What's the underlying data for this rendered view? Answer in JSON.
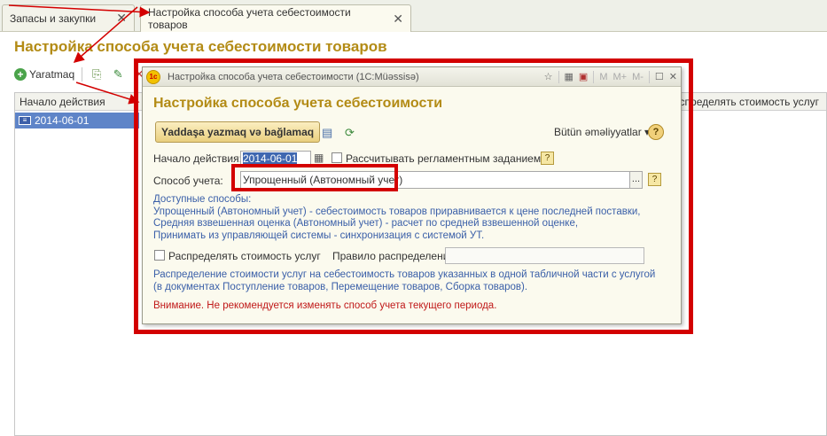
{
  "tabs": [
    {
      "label": "Запасы и закупки",
      "close": "✕"
    },
    {
      "label": "Настройка способа учета себестоимости товаров",
      "close": "✕"
    }
  ],
  "page": {
    "title": "Настройка способа учета себестоимости товаров",
    "create_label": "Yaratmaq",
    "list": {
      "col_start": "Начало действия",
      "col_distribute": "Распределять стоимость услуг",
      "rows": [
        {
          "date": "2014-06-01"
        }
      ]
    }
  },
  "dialog": {
    "window_title": "Настройка способа учета себестоимости  (1C:Müəssisə)",
    "logo_text": "1c",
    "title_buttons": {
      "m": "M",
      "m_plus": "M+",
      "m_minus": "M-"
    },
    "title": "Настройка способа учета себестоимости",
    "save_close_label": "Yaddaşa yazmaq və bağlamaq",
    "all_actions_label": "Bütün əməliyyatlar ▾",
    "help_label": "?",
    "start_label": "Начало действия:",
    "start_value": "2014-06-01",
    "regl_label": "Рассчитывать регламентным заданием",
    "qmark": "?",
    "method_label": "Способ учета:",
    "method_value": "Упрощенный (Автономный учет)",
    "method_dots": "...",
    "info_lines": [
      "Доступные способы:",
      "Упрощенный (Автономный учет) - себестоимость товаров приравнивается к цене последней поставки,",
      "Средняя взвешенная оценка (Автономный учет) - расчет по средней взвешенной оценке,",
      "Принимать из управляющей системы - синхронизация с системой УТ."
    ],
    "distribute_label": "Распределять стоимость услуг",
    "rule_label": "Правило распределения:",
    "distribute_info_lines": [
      "Распределение стоимости услуг на себестоимость товаров указанных в одной табличной части с услугой",
      "(в документах Поступление товаров, Перемещение товаров, Сборка товаров)."
    ],
    "warning": "Внимание. Не рекомендуется изменять способ учета текущего периода."
  },
  "colors": {
    "accent_title": "#b38b15",
    "annotation_red": "#d30000",
    "info_blue": "#3a5fa8",
    "selection": "#5e84c8"
  }
}
